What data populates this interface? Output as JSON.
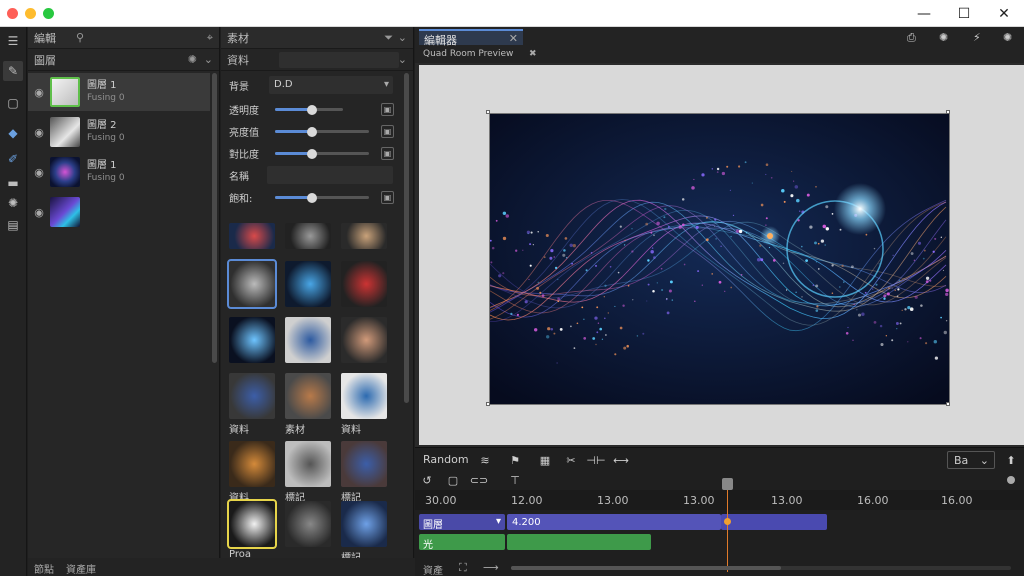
{
  "window": {
    "controls": {
      "minimize": "—",
      "maximize": "☐",
      "close": "✕"
    },
    "traffic_colors": [
      "#fe5f57",
      "#febc2e",
      "#28c840"
    ]
  },
  "tools": [
    {
      "icon": "menu-icon",
      "glyph": "☰"
    },
    {
      "icon": "pen-icon",
      "glyph": "✎"
    },
    {
      "icon": "frame-icon",
      "glyph": "▢"
    },
    {
      "icon": "bucket-icon",
      "glyph": "◆"
    },
    {
      "icon": "brush-icon",
      "glyph": "✐"
    },
    {
      "icon": "folder-icon",
      "glyph": "▬"
    },
    {
      "icon": "gear-icon",
      "glyph": "✺"
    },
    {
      "icon": "layers-icon",
      "glyph": "▤"
    }
  ],
  "layers_panel": {
    "title": "編輯",
    "subheader": "圖層",
    "layers": [
      {
        "name": "圖層 1",
        "sub": "Fusing 0",
        "selected": true,
        "thumb": "#7fb86a"
      },
      {
        "name": "圖層 2",
        "sub": "Fusing 0",
        "selected": false,
        "thumb": "#9a9a9a"
      },
      {
        "name": "圖層 1",
        "sub": "Fusing 0",
        "selected": false,
        "thumb": "#2c3f8a"
      },
      {
        "name": "",
        "sub": "",
        "selected": false,
        "thumb": "#3a2f7a"
      }
    ]
  },
  "assets_panel": {
    "title": "素材",
    "subheader": "資料",
    "props": [
      {
        "label": "背景",
        "value": "D.D"
      },
      {
        "label": "透明度",
        "slider": 0.55
      },
      {
        "label": "亮度值",
        "slider": 0.4
      },
      {
        "label": "對比度",
        "slider": 0.4
      },
      {
        "label": "名稱",
        "value": ""
      },
      {
        "label": "飽和:",
        "slider": 0.4
      }
    ],
    "tiles": [
      {
        "label": "",
        "colors": [
          "#1a2a4a",
          "#d94a4a"
        ]
      },
      {
        "label": "",
        "colors": [
          "#222",
          "#999"
        ]
      },
      {
        "label": "",
        "colors": [
          "#2a2a2a",
          "#c9a27a"
        ]
      },
      {
        "label": "",
        "colors": [
          "#2f2f2f",
          "#bbbbbb"
        ],
        "selected": true
      },
      {
        "label": "",
        "colors": [
          "#0e1a2e",
          "#49a6e6"
        ]
      },
      {
        "label": "",
        "colors": [
          "#222",
          "#cc3333"
        ]
      },
      {
        "label": "",
        "colors": [
          "#0a1020",
          "#6ec4ff"
        ]
      },
      {
        "label": "",
        "colors": [
          "#cfcfcf",
          "#2d5aa0"
        ]
      },
      {
        "label": "",
        "colors": [
          "#2b2b2b",
          "#d19a7a"
        ]
      },
      {
        "label": "資料",
        "colors": [
          "#383838",
          "#3c5ea8"
        ]
      },
      {
        "label": "素材",
        "colors": [
          "#4a4a4a",
          "#b87a4a"
        ]
      },
      {
        "label": "資料",
        "colors": [
          "#e6e6e6",
          "#2c6ab0"
        ]
      },
      {
        "label": "資料",
        "colors": [
          "#3a2a1a",
          "#d48a3a"
        ]
      },
      {
        "label": "標記",
        "colors": [
          "#bdbdbd",
          "#555"
        ]
      },
      {
        "label": "標記",
        "colors": [
          "#4a3a3a",
          "#3c5ea8"
        ]
      },
      {
        "label": "Proa",
        "colors": [
          "#1a1a1a",
          "#f2f2f2"
        ],
        "yellow": true
      },
      {
        "label": "",
        "colors": [
          "#2a2a2a",
          "#888"
        ]
      },
      {
        "label": "標記",
        "colors": [
          "#1a2a4a",
          "#6ea0e6"
        ]
      }
    ],
    "bottom_labels": [
      "資料",
      "",
      "標記"
    ]
  },
  "viewer": {
    "tab_title": "編輯器",
    "tab_sub": "Quad Room Preview",
    "toolbar_icons": [
      "export-icon",
      "gear-icon",
      "magic-icon",
      "settings-icon"
    ]
  },
  "timeline": {
    "label": "Random",
    "zoom_value": "Ba",
    "ticks": [
      "30.00",
      "12.00",
      "13.00",
      "13.00",
      "13.00",
      "16.00",
      "16.00"
    ],
    "tracks": [
      {
        "name": "圖層",
        "clip_label": "4.200",
        "color": "#5454b8"
      },
      {
        "name": "光",
        "clip_label": "",
        "color": "#3e9a4a"
      }
    ],
    "playhead_pct": 0.5
  },
  "status": {
    "left": "節點",
    "right": "資產庫"
  },
  "bottom_bar": {
    "left": "資產",
    "icons": [
      "fit-icon",
      "arrow-icon"
    ]
  }
}
